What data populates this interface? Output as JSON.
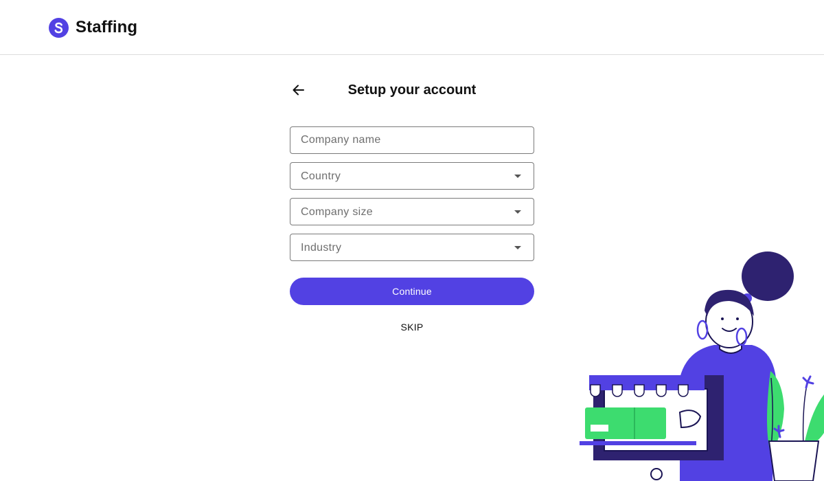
{
  "header": {
    "brand": "Staffing",
    "logo_letter": "S",
    "accent_color": "#5241e3"
  },
  "page": {
    "title": "Setup your account",
    "back_icon": "arrow-left-icon"
  },
  "form": {
    "company_name_placeholder": "Company name",
    "country_placeholder": "Country",
    "company_size_placeholder": "Company size",
    "industry_placeholder": "Industry",
    "dropdown_icon": "caret-down-icon",
    "continue_label": "Continue",
    "skip_label": "SKIP"
  },
  "illustration": {
    "name": "woman-holding-shop-illustration",
    "colors": {
      "primary": "#5241e3",
      "dark": "#2e2270",
      "green": "#3ddc6f"
    }
  }
}
